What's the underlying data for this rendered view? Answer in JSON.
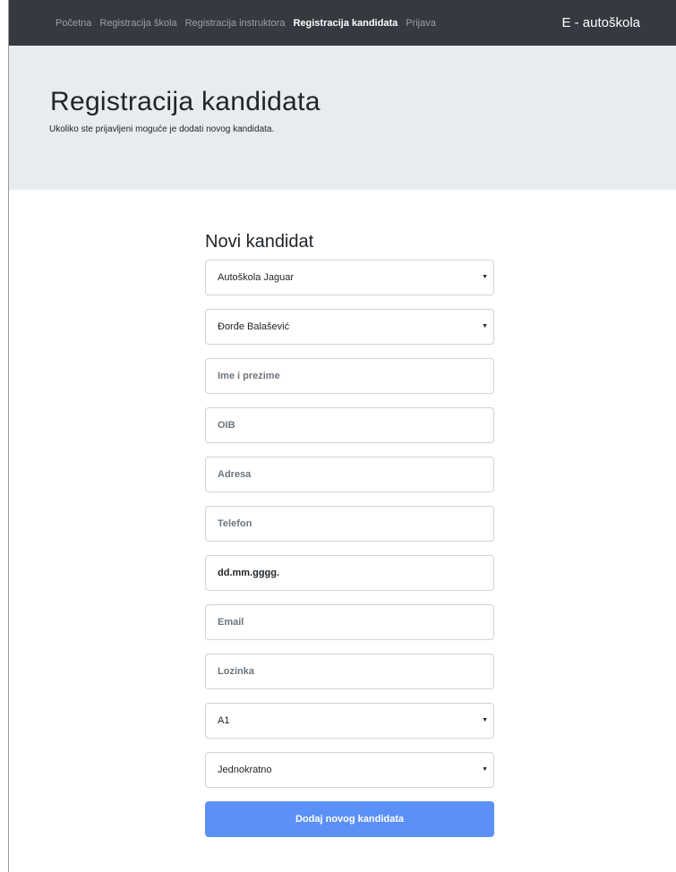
{
  "nav": {
    "links": [
      "Početna",
      "Registracija škola",
      "Registracija instruktora",
      "Registracija kandidata",
      "Prijava"
    ],
    "brand": "E - autoškola"
  },
  "header": {
    "title": "Registracija kandidata",
    "subtitle": "Ukoliko ste prijavljeni moguće je dodati novog kandidata."
  },
  "form": {
    "title": "Novi kandidat",
    "school_select": "Autoškola Jaguar",
    "instructor_select": "Đorđe Balašević",
    "name_placeholder": "Ime i prezime",
    "oib_placeholder": "OIB",
    "address_placeholder": "Adresa",
    "phone_placeholder": "Telefon",
    "date_placeholder": "dd.mm.gggg.",
    "email_placeholder": "Email",
    "password_placeholder": "Lozinka",
    "category_select": "A1",
    "payment_select": "Jednokratno",
    "submit_label": "Dodaj novog kandidata"
  }
}
